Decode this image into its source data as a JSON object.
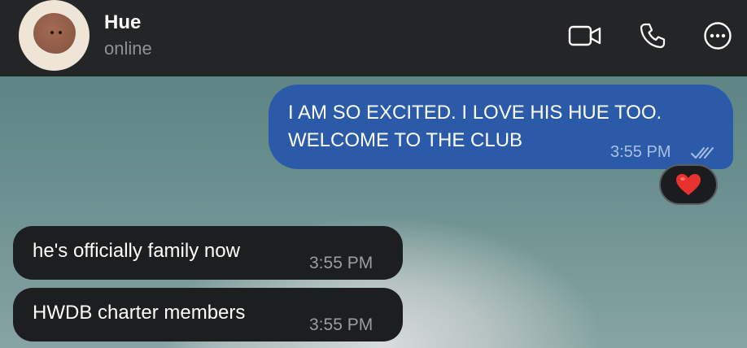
{
  "header": {
    "contact_name": "Hue",
    "status": "online",
    "icons": [
      "video-camera-icon",
      "phone-icon",
      "more-options-icon"
    ]
  },
  "messages": [
    {
      "direction": "outgoing",
      "text": "I AM SO EXCITED. I LOVE HIS HUE TOO. WELCOME TO THE CLUB",
      "time": "3:55 PM",
      "read": true,
      "reaction": "❤️"
    },
    {
      "direction": "incoming",
      "text": "he's officially family now",
      "time": "3:55 PM"
    },
    {
      "direction": "incoming",
      "text": "HWDB charter members",
      "time": "3:55 PM"
    }
  ],
  "colors": {
    "header_bg": "#242526",
    "outgoing_bubble": "#2b5aa8",
    "incoming_bubble": "#1d1e1f",
    "status_text": "#8e9195"
  }
}
